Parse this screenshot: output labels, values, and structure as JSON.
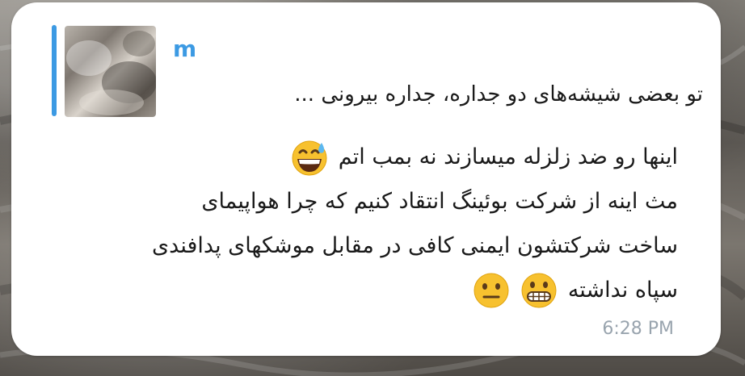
{
  "reply": {
    "sender": "m",
    "text": "تو بعضی شیشه‌های دو جداره، جداره بیرونی ..."
  },
  "message": {
    "line1": "اینها رو ضد زلزله میسازند نه بمب اتم",
    "line2": "مث اینه از شرکت بوئینگ انتقاد کنیم که چرا هواپیمای",
    "line3": "ساخت شرکتشون ایمنی کافی در مقابل موشکهای پدافندی",
    "line4": "سپاه نداشته",
    "emojis": [
      "grinning-sweat-emoji",
      "grimacing-emoji",
      "neutral-face-emoji"
    ]
  },
  "time": "6:28 PM",
  "colors": {
    "accent": "#3c9ae3",
    "bubble": "#ffffff",
    "text": "#1a1a1a",
    "time": "#99a4ae",
    "emoji": "#f7c12f"
  }
}
